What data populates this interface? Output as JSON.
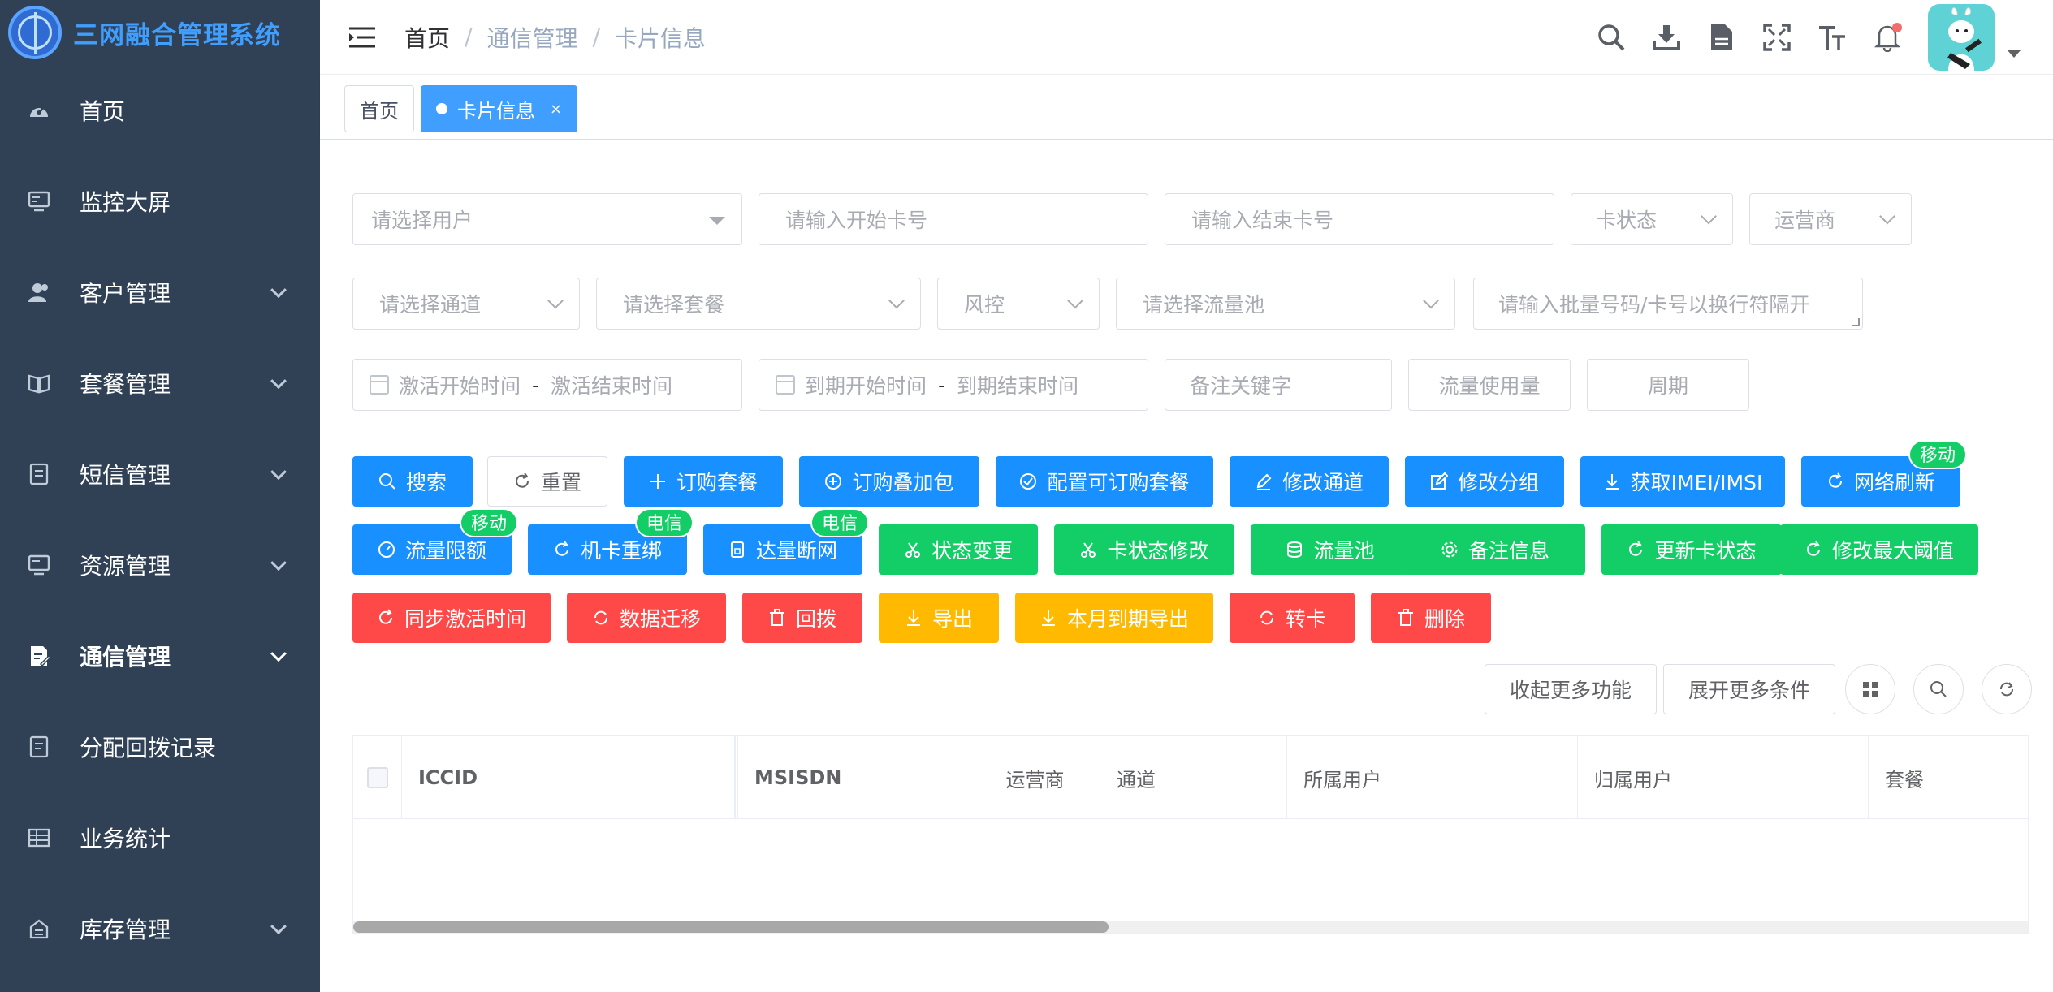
{
  "app": {
    "title": "三网融合管理系统",
    "logo_icon": "globe-icon"
  },
  "sidebar": {
    "items": [
      {
        "label": "首页",
        "icon": "dashboard-icon",
        "has_children": false
      },
      {
        "label": "监控大屏",
        "icon": "monitor-icon",
        "has_children": false
      },
      {
        "label": "客户管理",
        "icon": "people-icon",
        "has_children": true
      },
      {
        "label": "套餐管理",
        "icon": "package-icon",
        "has_children": true
      },
      {
        "label": "短信管理",
        "icon": "message-icon",
        "has_children": true
      },
      {
        "label": "资源管理",
        "icon": "resource-icon",
        "has_children": true
      },
      {
        "label": "通信管理",
        "icon": "edit-icon",
        "has_children": true
      },
      {
        "label": "分配回拨记录",
        "icon": "record-icon",
        "has_children": false
      },
      {
        "label": "业务统计",
        "icon": "table-icon",
        "has_children": false
      },
      {
        "label": "库存管理",
        "icon": "storage-icon",
        "has_children": true
      }
    ],
    "active_index": 6
  },
  "header": {
    "breadcrumb": [
      "首页",
      "通信管理",
      "卡片信息"
    ],
    "breadcrumb_sep": "/",
    "tools": [
      "search-icon",
      "download-icon",
      "document-icon",
      "fullscreen-icon",
      "font-size-icon",
      "bell-icon"
    ],
    "has_notification": true
  },
  "tags": [
    {
      "label": "首页",
      "active": false
    },
    {
      "label": "卡片信息",
      "active": true,
      "close": "×"
    }
  ],
  "filters": {
    "user_placeholder": "请选择用户",
    "start_card_placeholder": "请输入开始卡号",
    "end_card_placeholder": "请输入结束卡号",
    "card_status_placeholder": "卡状态",
    "operator_placeholder": "运营商",
    "channel_placeholder": "请选择通道",
    "package_placeholder": "请选择套餐",
    "risk_placeholder": "风控",
    "pool_placeholder": "请选择流量池",
    "batch_placeholder": "请输入批量号码/卡号以换行符隔开",
    "activate_start": "激活开始时间",
    "activate_end": "激活结束时间",
    "expire_start": "到期开始时间",
    "expire_end": "到期结束时间",
    "range_sep": "-",
    "remark_placeholder": "备注关键字",
    "usage_placeholder": "流量使用量",
    "period_placeholder": "周期"
  },
  "buttons": {
    "search": "搜索",
    "reset": "重置",
    "order_package": "订购套餐",
    "order_addon": "订购叠加包",
    "config_package": "配置可订购套餐",
    "modify_channel": "修改通道",
    "modify_group": "修改分组",
    "get_imei": "获取IMEI/IMSI",
    "network_refresh": "网络刷新",
    "flow_limit": "流量限额",
    "rebind": "机卡重绑",
    "cutoff": "达量断网",
    "status_change": "状态变更",
    "card_status_modify": "卡状态修改",
    "flow_pool": "流量池",
    "remark_info": "备注信息",
    "update_status": "更新卡状态",
    "modify_threshold": "修改最大阈值",
    "sync_activate": "同步激活时间",
    "data_migrate": "数据迁移",
    "callback": "回拨",
    "export": "导出",
    "export_month": "本月到期导出",
    "transfer": "转卡",
    "delete": "删除"
  },
  "badges": {
    "network_refresh": "移动",
    "flow_limit": "移动",
    "rebind": "电信",
    "cutoff": "电信"
  },
  "toolbar_right": {
    "collapse": "收起更多功能",
    "expand": "展开更多条件",
    "icons": [
      "grid-icon",
      "search-icon",
      "refresh-icon"
    ]
  },
  "table": {
    "columns": [
      "ICCID",
      "MSISDN",
      "运营商",
      "通道",
      "所属用户",
      "归属用户",
      "套餐"
    ],
    "rows": []
  },
  "colors": {
    "sidebar_bg": "#304156",
    "primary": "#1890ff",
    "success": "#13ce66",
    "danger": "#ff4949",
    "warning": "#ffba00",
    "brand": "#409eff"
  }
}
